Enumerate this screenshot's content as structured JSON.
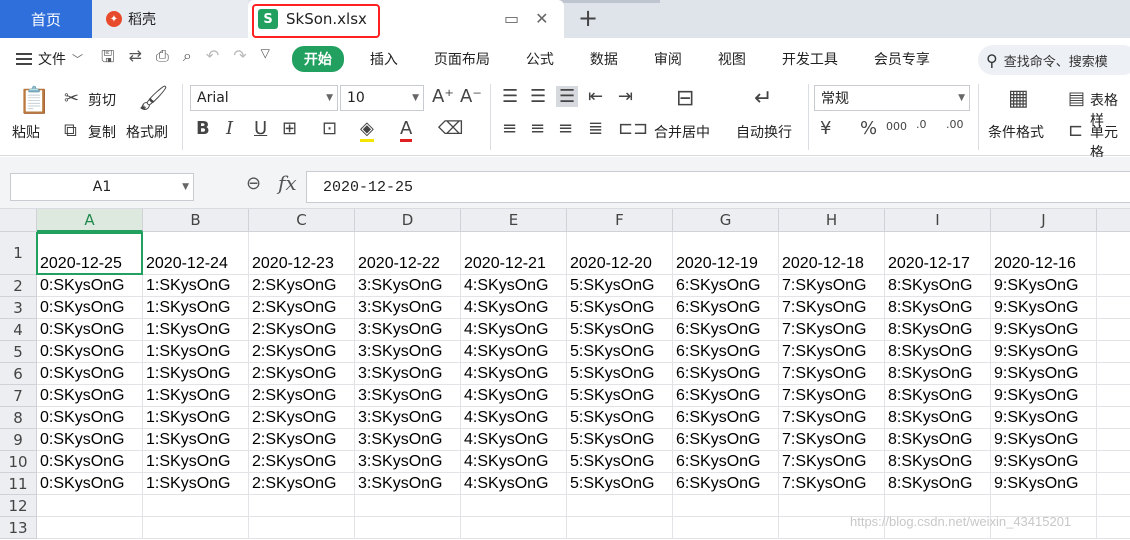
{
  "tabs": {
    "home": "首页",
    "daoke": "稻壳",
    "active_file": "SkSon.xlsx",
    "new_tab": "+"
  },
  "menu": {
    "file": "文件",
    "start": "开始",
    "items": [
      "插入",
      "页面布局",
      "公式",
      "数据",
      "审阅",
      "视图",
      "开发工具",
      "会员专享"
    ],
    "search_placeholder": "查找命令、搜索模"
  },
  "ribbon": {
    "paste": "粘贴",
    "cut": "剪切",
    "copy": "复制",
    "format_painter": "格式刷",
    "font_name": "Arial",
    "font_size": "10",
    "merge_center": "合并居中",
    "wrap_text": "自动换行",
    "number_format": "常规",
    "conditional_format": "条件格式",
    "table_style": "表格样",
    "cell_style": "单元格"
  },
  "formula_bar": {
    "name_box": "A1",
    "fx": "fx",
    "content": "2020-12-25"
  },
  "grid": {
    "columns": [
      "A",
      "B",
      "C",
      "D",
      "E",
      "F",
      "G",
      "H",
      "I",
      "J"
    ],
    "rows": [
      "1",
      "2",
      "3",
      "4",
      "5",
      "6",
      "7",
      "8",
      "9",
      "10",
      "11",
      "12",
      "13"
    ],
    "header_row": [
      "2020-12-25",
      "2020-12-24",
      "2020-12-23",
      "2020-12-22",
      "2020-12-21",
      "2020-12-20",
      "2020-12-19",
      "2020-12-18",
      "2020-12-17",
      "2020-12-16"
    ],
    "data_row": [
      "0:SKysOnG",
      "1:SKysOnG",
      "2:SKysOnG",
      "3:SKysOnG",
      "4:SKysOnG",
      "5:SKysOnG",
      "6:SKysOnG",
      "7:SKysOnG",
      "8:SKysOnG",
      "9:SKysOnG"
    ],
    "data_row_count": 10
  },
  "watermark": "https://blog.csdn.net/weixin_43415201",
  "colors": {
    "accent": "#21a060",
    "home_tab": "#2f6fdb",
    "highlight": "#ff2020"
  }
}
